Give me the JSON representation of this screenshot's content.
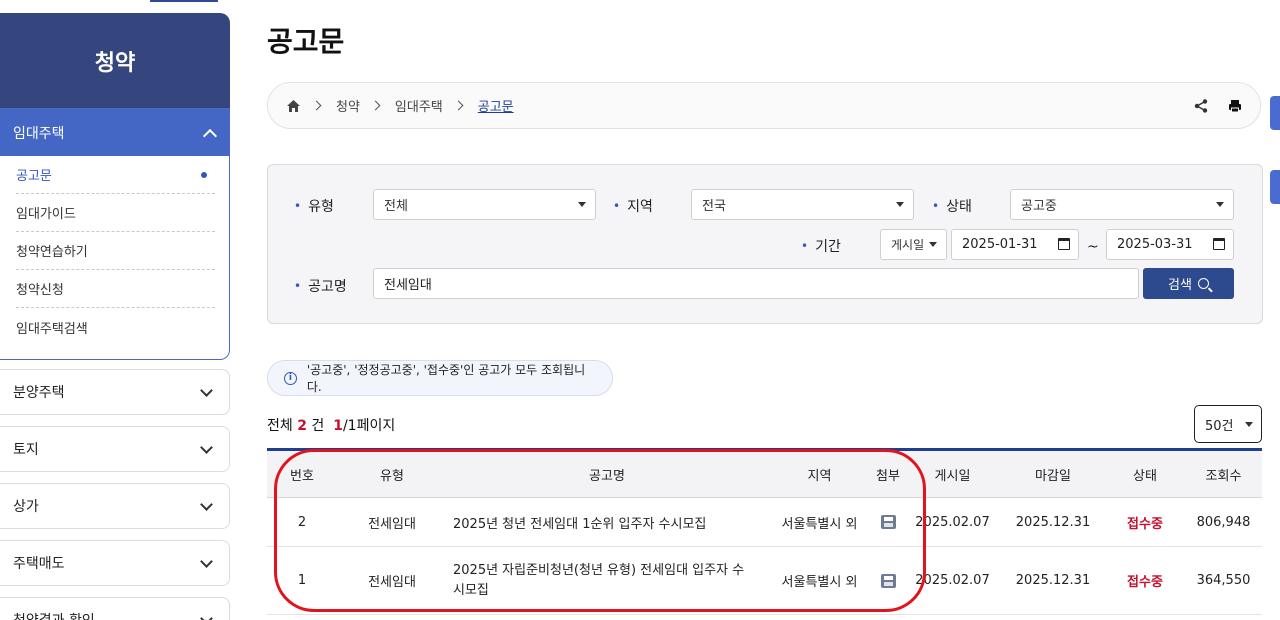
{
  "sidebar": {
    "title": "청약",
    "active_group": "임대주택",
    "sub_items": [
      {
        "label": "공고문",
        "active": true
      },
      {
        "label": "임대가이드"
      },
      {
        "label": "청약연습하기"
      },
      {
        "label": "청약신청"
      },
      {
        "label": "임대주택검색"
      }
    ],
    "groups": [
      "분양주택",
      "토지",
      "상가",
      "주택매도",
      "청약결과 확인"
    ]
  },
  "page": {
    "title": "공고문"
  },
  "breadcrumb": {
    "items": [
      "청약",
      "임대주택",
      "공고문"
    ],
    "icons": [
      "home-icon",
      "share-icon",
      "print-icon"
    ]
  },
  "filter": {
    "type_label": "유형",
    "type_value": "전체",
    "region_label": "지역",
    "region_value": "전국",
    "status_label": "상태",
    "status_value": "공고중",
    "period_label": "기간",
    "period_type": "게시일",
    "date_from": "2025-01-31",
    "date_sep": "~",
    "date_to": "2025-03-31",
    "name_label": "공고명",
    "name_value": "전세임대",
    "search_button": "검색"
  },
  "notice": "'공고중', '정정공고중', '접수중'인 공고가 모두 조회됩니다.",
  "summary": {
    "prefix": "전체",
    "total": "2",
    "unit": "건",
    "page": "1",
    "pages": "/1페이지",
    "per_page": "50건"
  },
  "table": {
    "headers": [
      "번호",
      "유형",
      "공고명",
      "지역",
      "첨부",
      "게시일",
      "마감일",
      "상태",
      "조회수"
    ],
    "rows": [
      {
        "no": "2",
        "type": "전세임대",
        "title": "2025년 청년 전세임대 1순위 입주자 수시모집",
        "region": "서울특별시 외",
        "posted": "2025.02.07",
        "deadline": "2025.12.31",
        "status": "접수중",
        "views": "806,948"
      },
      {
        "no": "1",
        "type": "전세임대",
        "title": "2025년 자립준비청년(청년 유형) 전세임대 입주자 수시모집",
        "region": "서울특별시 외",
        "posted": "2025.02.07",
        "deadline": "2025.12.31",
        "status": "접수중",
        "views": "364,550"
      }
    ]
  },
  "colors": {
    "sidebar_head": "#35467f",
    "accent": "#4466c4",
    "status_red": "#c8102e",
    "highlight": "#e3131b"
  }
}
